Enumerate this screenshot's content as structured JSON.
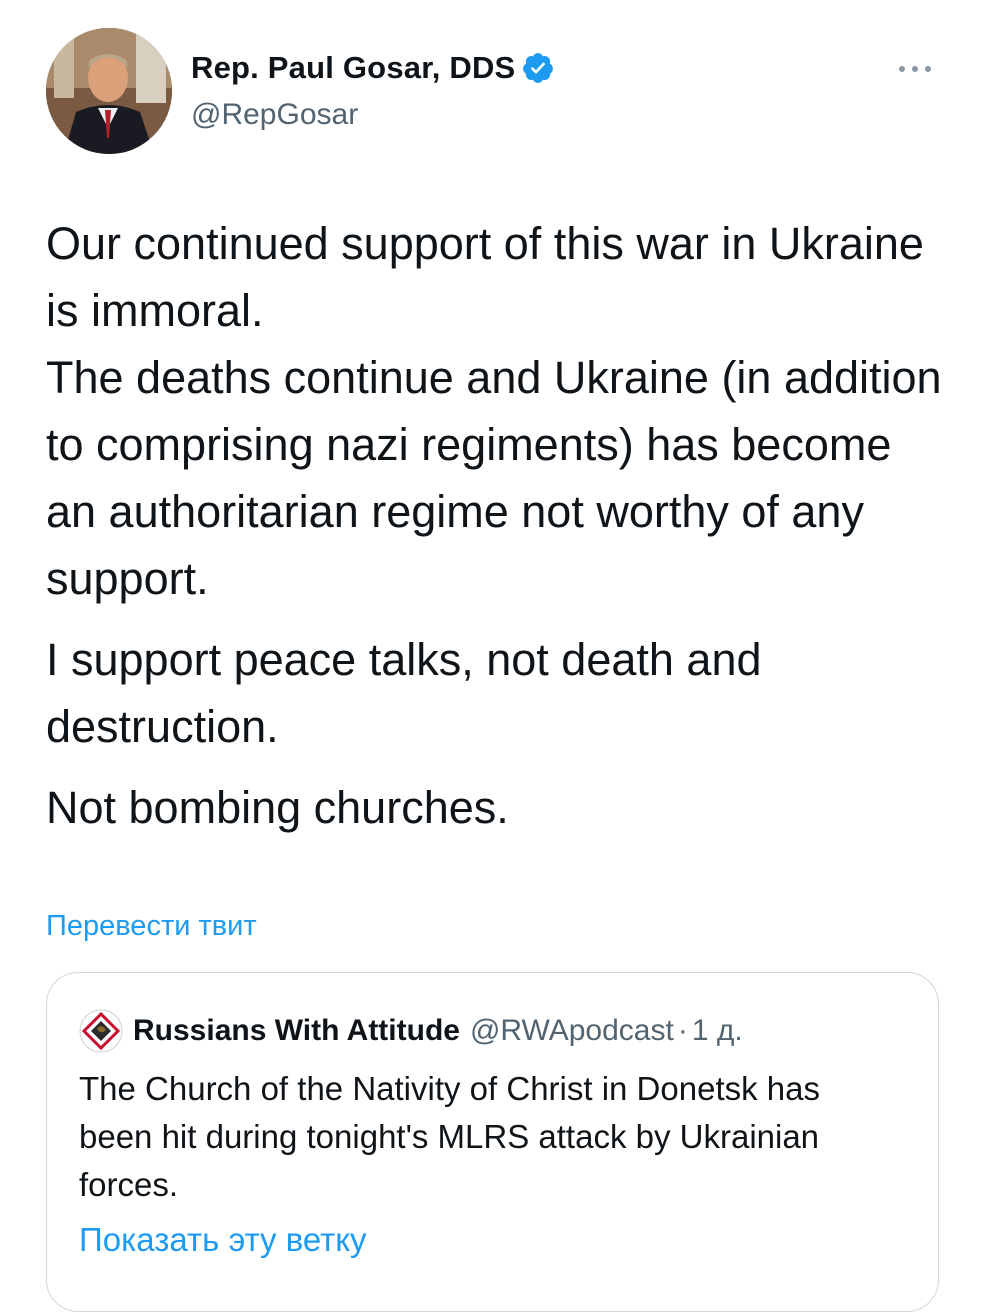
{
  "author": {
    "name": "Rep. Paul Gosar, DDS",
    "handle": "@RepGosar",
    "verified": true
  },
  "tweet": {
    "paragraphs": [
      "Our continued support of this war in Ukraine is immoral.",
      "The deaths continue and Ukraine (in addition to comprising nazi regiments) has become an authoritarian regime not worthy of any support.",
      "I support peace talks, not death and destruction.",
      "Not bombing churches."
    ]
  },
  "translate_label": "Перевести твит",
  "quoted_tweet": {
    "name": "Russians With Attitude",
    "handle": "@RWApodcast",
    "separator": "·",
    "time": "1 д.",
    "text": "The Church of the Nativity of Christ in Donetsk has been hit during tonight's MLRS attack by Ukrainian forces.",
    "show_thread_label": "Показать эту ветку"
  },
  "icons": {
    "verified": "verified-badge-icon",
    "more": "more-options-icon",
    "quote_avatar": "diamond-logo-icon"
  },
  "colors": {
    "link": "#1d9bf0",
    "text": "#0f1419",
    "secondary": "#536471",
    "verified": "#1d9bf0",
    "border": "#cfd9de"
  }
}
